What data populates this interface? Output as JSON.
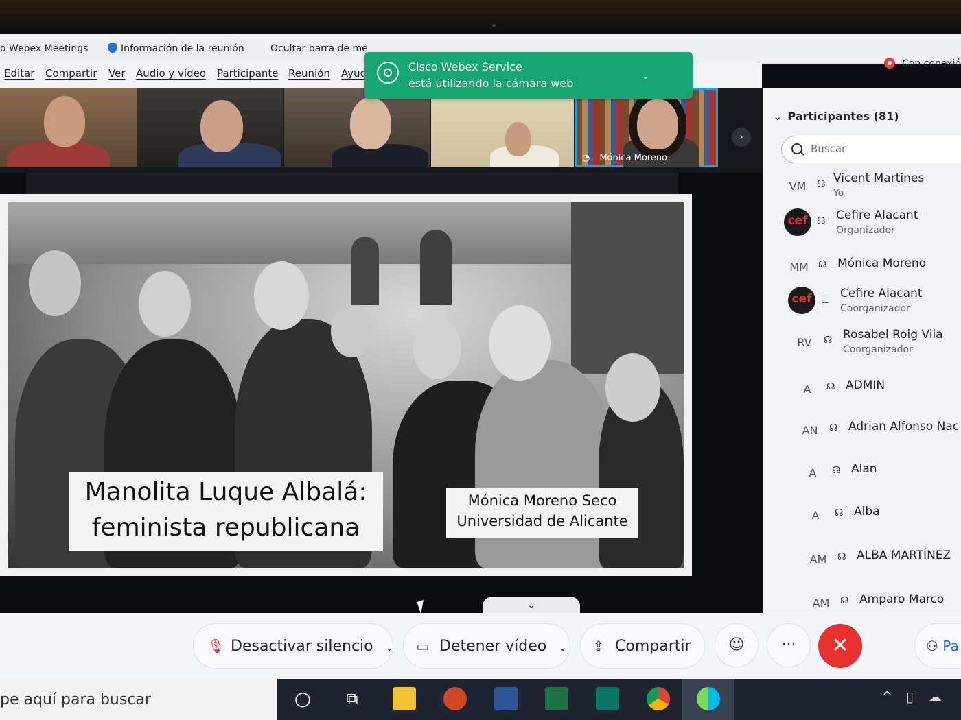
{
  "title_bar": {
    "app_name": "Webex Meetings",
    "meeting_info": "Información de la reunión",
    "hide_bar": "Ocultar barra de me",
    "connection": "Con conexió"
  },
  "menu": [
    "Editar",
    "Compartir",
    "Ver",
    "Audio y vídeo",
    "Participante",
    "Reunión",
    "Ayud"
  ],
  "notification": {
    "title": "Cisco Webex Service",
    "message": "está utilizando la cámara web"
  },
  "video_strip": {
    "active_speaker": "Mónica Moreno"
  },
  "slide": {
    "title_line1": "Manolita Luque Albalá:",
    "title_line2": "feminista republicana",
    "author": "Mónica Moreno Seco",
    "institution": "Universidad de Alicante"
  },
  "participants": {
    "header": "Participantes (81)",
    "search_placeholder": "Buscar",
    "list": [
      {
        "initials": "VM",
        "name": "Vicent Martines",
        "role": "Yo"
      },
      {
        "initials": "cef",
        "name": "Cefire Alacant",
        "role": "Organizador"
      },
      {
        "initials": "MM",
        "name": "Mónica Moreno",
        "role": ""
      },
      {
        "initials": "cef",
        "name": "Cefire Alacant",
        "role": "Coorganizador"
      },
      {
        "initials": "RV",
        "name": "Rosabel Roig Vila",
        "role": "Coorganizador"
      },
      {
        "initials": "A",
        "name": "ADMIN",
        "role": ""
      },
      {
        "initials": "AN",
        "name": "Adrian Alfonso Nac",
        "role": ""
      },
      {
        "initials": "A",
        "name": "Alan",
        "role": ""
      },
      {
        "initials": "A",
        "name": "Alba",
        "role": ""
      },
      {
        "initials": "AM",
        "name": "ALBA MARTÍNEZ",
        "role": ""
      },
      {
        "initials": "AM",
        "name": "Amparo Marco",
        "role": ""
      }
    ]
  },
  "controls": {
    "mute": "Desactivar silencio",
    "video": "Detener vídeo",
    "share": "Compartir",
    "more": "···",
    "participants_short": "Pa"
  },
  "taskbar": {
    "search_text": "pe aquí para buscar"
  },
  "colors": {
    "accent_green": "#16a673",
    "end_red": "#e6312f",
    "active_blue": "#19a4e6"
  }
}
